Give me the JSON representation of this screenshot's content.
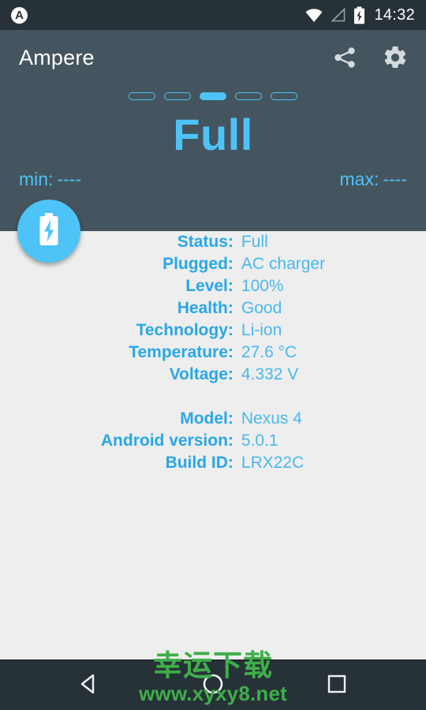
{
  "statusbar": {
    "notification_icon": "app-notification-icon",
    "notification_letter": "A",
    "wifi_icon": "wifi-icon",
    "signal_icon": "cell-signal-icon",
    "battery_icon": "battery-charging-icon",
    "time": "14:32"
  },
  "header": {
    "title": "Ampere",
    "share_icon": "share-icon",
    "settings_icon": "gear-icon",
    "pager": {
      "count": 5,
      "active_index": 2
    },
    "reading": "Full",
    "min_label": "min:",
    "min_value": "----",
    "max_label": "max:",
    "max_value": "----",
    "fab_icon": "battery-charging-icon",
    "accent_color": "#4ec3f7",
    "background_color": "#44555f"
  },
  "content": {
    "background_color": "#eeeeee",
    "label_color": "#29a7e8",
    "value_color": "#4ab8ef",
    "battery_rows": [
      {
        "label": "Status:",
        "value": "Full"
      },
      {
        "label": "Plugged:",
        "value": "AC charger"
      },
      {
        "label": "Level:",
        "value": "100%"
      },
      {
        "label": "Health:",
        "value": "Good"
      },
      {
        "label": "Technology:",
        "value": "Li-ion"
      },
      {
        "label": "Temperature:",
        "value": "27.6 °C"
      },
      {
        "label": "Voltage:",
        "value": "4.332 V"
      }
    ],
    "device_rows": [
      {
        "label": "Model:",
        "value": "Nexus 4"
      },
      {
        "label": "Android version:",
        "value": "5.0.1"
      },
      {
        "label": "Build ID:",
        "value": "LRX22C"
      }
    ]
  },
  "navbar": {
    "back_icon": "back-triangle-icon",
    "home_icon": "home-circle-icon",
    "recent_icon": "recents-square-icon",
    "background_color": "#263238"
  },
  "watermark": {
    "line1": "幸运下载",
    "line2": "www.xyxy8.net",
    "color": "#3fae4a"
  }
}
